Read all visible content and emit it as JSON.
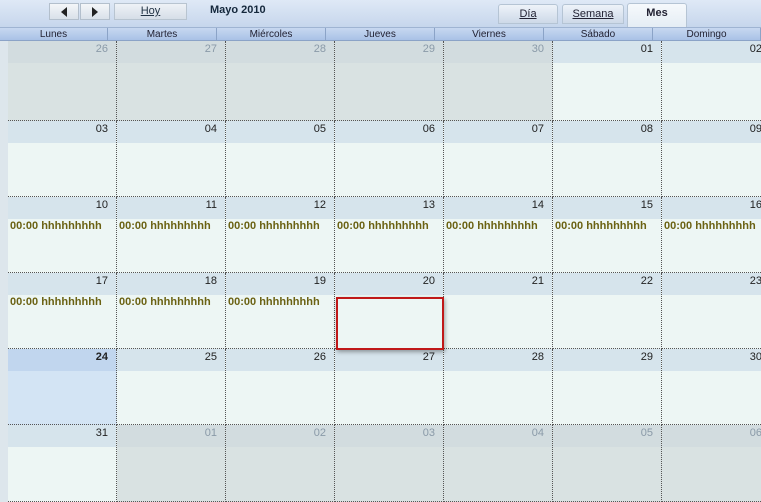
{
  "toolbar": {
    "prev_label": "",
    "next_label": "",
    "today_label": "Hoy",
    "title": "Mayo 2010",
    "tabs": [
      {
        "label": "Día",
        "active": false
      },
      {
        "label": "Semana",
        "active": false
      },
      {
        "label": "Mes",
        "active": true
      }
    ]
  },
  "day_names": [
    "Lunes",
    "Martes",
    "Miércoles",
    "Jueves",
    "Viernes",
    "Sábado",
    "Domingo"
  ],
  "weeks": [
    [
      {
        "day": "26",
        "other": true
      },
      {
        "day": "27",
        "other": true
      },
      {
        "day": "28",
        "other": true
      },
      {
        "day": "29",
        "other": true
      },
      {
        "day": "30",
        "other": true
      },
      {
        "day": "01"
      },
      {
        "day": "02"
      }
    ],
    [
      {
        "day": "03"
      },
      {
        "day": "04"
      },
      {
        "day": "05"
      },
      {
        "day": "06"
      },
      {
        "day": "07"
      },
      {
        "day": "08"
      },
      {
        "day": "09"
      }
    ],
    [
      {
        "day": "10",
        "event": "00:00 hhhhhhhhh"
      },
      {
        "day": "11",
        "event": "00:00 hhhhhhhhh"
      },
      {
        "day": "12",
        "event": "00:00 hhhhhhhhh"
      },
      {
        "day": "13",
        "event": "00:00 hhhhhhhhh"
      },
      {
        "day": "14",
        "event": "00:00 hhhhhhhhh"
      },
      {
        "day": "15",
        "event": "00:00 hhhhhhhhh"
      },
      {
        "day": "16",
        "event": "00:00 hhhhhhhhh"
      }
    ],
    [
      {
        "day": "17",
        "event": "00:00 hhhhhhhhh"
      },
      {
        "day": "18",
        "event": "00:00 hhhhhhhhh"
      },
      {
        "day": "19",
        "event": "00:00 hhhhhhhhh"
      },
      {
        "day": "20"
      },
      {
        "day": "21"
      },
      {
        "day": "22"
      },
      {
        "day": "23"
      }
    ],
    [
      {
        "day": "24",
        "today": true
      },
      {
        "day": "25"
      },
      {
        "day": "26"
      },
      {
        "day": "27"
      },
      {
        "day": "28"
      },
      {
        "day": "29"
      },
      {
        "day": "30"
      }
    ],
    [
      {
        "day": "31"
      },
      {
        "day": "01",
        "other": true
      },
      {
        "day": "02",
        "other": true
      },
      {
        "day": "03",
        "other": true
      },
      {
        "day": "04",
        "other": true
      },
      {
        "day": "05",
        "other": true
      },
      {
        "day": "06",
        "other": true
      }
    ]
  ]
}
